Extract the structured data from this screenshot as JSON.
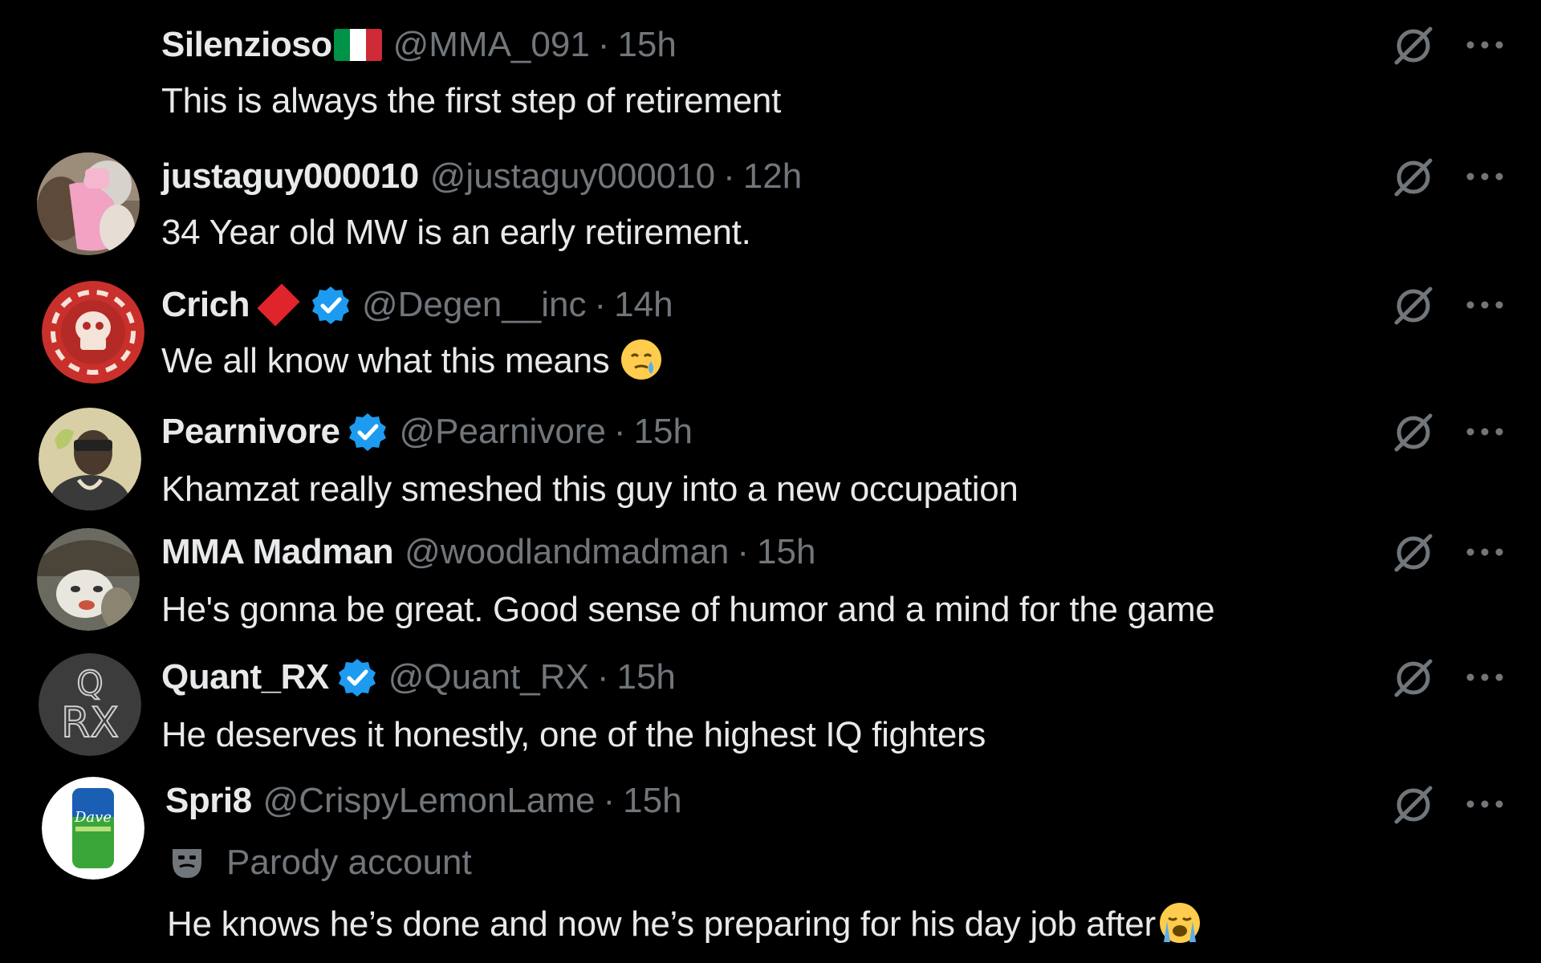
{
  "replies": [
    {
      "name": "Silenzioso",
      "badge": "italy-flag",
      "handle": "@MMA_091",
      "separator": "·",
      "time": "15h",
      "text": "This is always the first step of retirement"
    },
    {
      "name": "justaguy000010",
      "handle": "@justaguy000010",
      "separator": "·",
      "time": "12h",
      "text": "34 Year old MW is an early retirement."
    },
    {
      "name": "Crich",
      "badge": "red-diamond",
      "verified": true,
      "handle": "@Degen__inc",
      "separator": "·",
      "time": "14h",
      "text": "We all know what this means",
      "emoji": "face-holding-back-tears-icon"
    },
    {
      "name": "Pearnivore",
      "verified": true,
      "handle": "@Pearnivore",
      "separator": "·",
      "time": "15h",
      "text": "Khamzat really smeshed this guy into a new occupation"
    },
    {
      "name": "MMA Madman",
      "handle": "@woodlandmadman",
      "separator": "·",
      "time": "15h",
      "text": "He's gonna be great.  Good sense of humor and a mind for the game"
    },
    {
      "name": "Quant_RX",
      "verified": true,
      "handle": "@Quant_RX",
      "separator": "·",
      "time": "15h",
      "text": "He deserves it honestly, one of the highest IQ fighters"
    },
    {
      "name": "Spri8",
      "handle": "@CrispyLemonLame",
      "separator": "·",
      "time": "15h",
      "label": "Parody account",
      "text": "He knows he’s done and now he’s preparing for his day job after",
      "emoji": "loudly-crying-face-icon"
    }
  ],
  "avatars": {
    "quant_rx_letters_top": "Q",
    "quant_rx_letters_bottom": "RX",
    "spri8_can_text": "Dave"
  },
  "colors": {
    "background": "#000000",
    "primary_text": "#e7e9ea",
    "secondary_text": "#71767b",
    "verified_blue": "#1d9bf0"
  }
}
